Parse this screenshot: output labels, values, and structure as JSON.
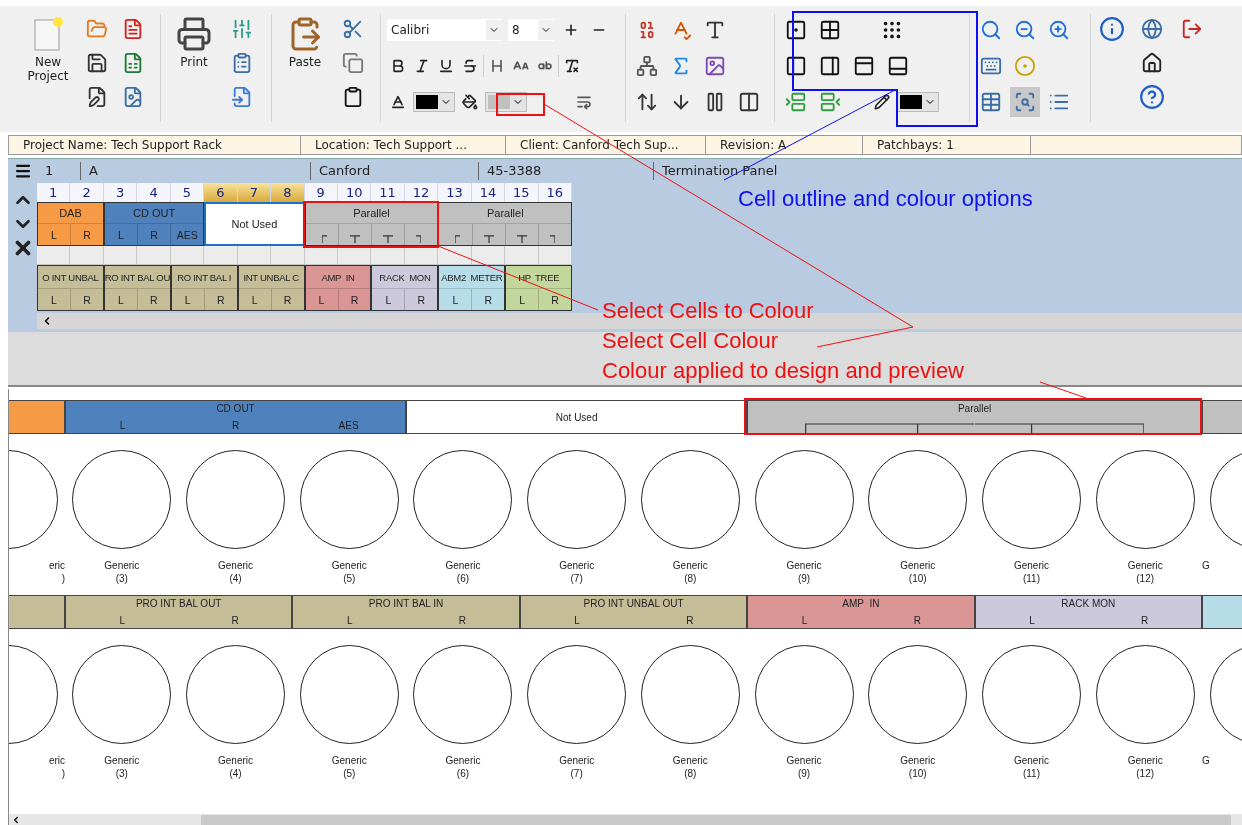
{
  "toolbar": {
    "new_project": "New Project",
    "print": "Print",
    "paste": "Paste",
    "font": "Calibri",
    "font_size": "8",
    "view_buttons": [
      {
        "pressed": false
      },
      {
        "pressed": true
      },
      {
        "pressed": false
      }
    ]
  },
  "project_bar": [
    "Project Name: Tech Support Rack",
    "Location: Tech Support ...",
    "Client: Canford Tech Sup...",
    "Revision: A",
    "Patchbays: 1"
  ],
  "editor": {
    "fields": [
      "1",
      "A",
      "Canford",
      "45-3388",
      "Termination Panel"
    ],
    "columns": [
      {
        "label": "1",
        "selected": false
      },
      {
        "label": "2",
        "selected": false
      },
      {
        "label": "3",
        "selected": false
      },
      {
        "label": "4",
        "selected": false
      },
      {
        "label": "5",
        "selected": false
      },
      {
        "label": "6",
        "selected": true
      },
      {
        "label": "7",
        "selected": true
      },
      {
        "label": "8",
        "selected": true
      },
      {
        "label": "9",
        "selected": false
      },
      {
        "label": "10",
        "selected": false
      },
      {
        "label": "11",
        "selected": false
      },
      {
        "label": "12",
        "selected": false
      },
      {
        "label": "13",
        "selected": false
      },
      {
        "label": "14",
        "selected": false
      },
      {
        "label": "15",
        "selected": false
      },
      {
        "label": "16",
        "selected": false
      }
    ],
    "top_groups": [
      {
        "label": "DAB",
        "color": "#f79a46",
        "selected": false,
        "ports": [
          {
            "kind": "label",
            "text": "L"
          },
          {
            "kind": "label",
            "text": "R"
          }
        ]
      },
      {
        "label": "CD OUT",
        "color": "#4f81bd",
        "selected": false,
        "ports": [
          {
            "kind": "label",
            "text": "L"
          },
          {
            "kind": "label",
            "text": "R"
          },
          {
            "kind": "label",
            "text": "AES"
          }
        ]
      },
      {
        "label": "Not Used",
        "color": "#ffffff",
        "selected": true,
        "ports": [
          {
            "kind": "blank"
          },
          {
            "kind": "blank"
          },
          {
            "kind": "blank"
          }
        ]
      },
      {
        "label": "Parallel",
        "color": "#c0c0c0",
        "selected": false,
        "ports": [
          {
            "kind": "first"
          },
          {
            "kind": "middle"
          },
          {
            "kind": "middle"
          },
          {
            "kind": "last"
          }
        ]
      },
      {
        "label": "Parallel",
        "color": "#c0c0c0",
        "selected": false,
        "ports": [
          {
            "kind": "first"
          },
          {
            "kind": "middle"
          },
          {
            "kind": "middle"
          },
          {
            "kind": "last"
          }
        ]
      }
    ],
    "bottom_groups": [
      {
        "label": "O INT UNBAL",
        "color": "#c4bd97",
        "selected": false,
        "ports": [
          {
            "kind": "label",
            "text": "L"
          },
          {
            "kind": "label",
            "text": "R"
          }
        ]
      },
      {
        "label": "RO INT BAL OU",
        "color": "#c4bd97",
        "selected": false,
        "ports": [
          {
            "kind": "label",
            "text": "L"
          },
          {
            "kind": "label",
            "text": "R"
          }
        ]
      },
      {
        "label": "RO INT BAL I",
        "color": "#c4bd97",
        "selected": false,
        "ports": [
          {
            "kind": "label",
            "text": "L"
          },
          {
            "kind": "label",
            "text": "R"
          }
        ]
      },
      {
        "label": "INT UNBAL C",
        "color": "#c4bd97",
        "selected": false,
        "ports": [
          {
            "kind": "label",
            "text": "L"
          },
          {
            "kind": "label",
            "text": "R"
          }
        ]
      },
      {
        "label": "AMP  IN",
        "color": "#d99694",
        "selected": false,
        "ports": [
          {
            "kind": "label",
            "text": "L"
          },
          {
            "kind": "label",
            "text": "R"
          }
        ]
      },
      {
        "label": "RACK  MON",
        "color": "#ccc9dc",
        "selected": false,
        "ports": [
          {
            "kind": "label",
            "text": "L"
          },
          {
            "kind": "label",
            "text": "R"
          }
        ]
      },
      {
        "label": "ABM2  METER",
        "color": "#b7dee8",
        "selected": false,
        "ports": [
          {
            "kind": "label",
            "text": "L"
          },
          {
            "kind": "label",
            "text": "R"
          }
        ]
      },
      {
        "label": "HP  TREE",
        "color": "#c3d69b",
        "selected": false,
        "ports": [
          {
            "kind": "label",
            "text": "L"
          },
          {
            "kind": "label",
            "text": "R"
          }
        ]
      }
    ]
  },
  "preview": {
    "rows": [
      {
        "groups": [
          {
            "color": "#f79a46",
            "ports": [
              {
                "kind": "blank"
              }
            ]
          },
          {
            "label": "CD OUT",
            "color": "#4f81bd",
            "ports": [
              {
                "kind": "label",
                "text": "L"
              },
              {
                "kind": "label",
                "text": "R"
              },
              {
                "kind": "label",
                "text": "AES"
              }
            ]
          },
          {
            "label": "Not Used",
            "color": "#ffffff",
            "ports": [
              {
                "kind": "blank"
              },
              {
                "kind": "blank"
              },
              {
                "kind": "blank"
              }
            ]
          },
          {
            "label": "Parallel",
            "color": "#c0c0c0",
            "ports": [
              {
                "kind": "first"
              },
              {
                "kind": "middle"
              },
              {
                "kind": "middle"
              },
              {
                "kind": "last"
              }
            ]
          },
          {
            "color": "#c0c0c0",
            "ports": [
              {
                "kind": "blank"
              }
            ]
          }
        ],
        "sockets": [
          {
            "name": "eric",
            "number": ")"
          },
          {
            "name": "Generic",
            "number": "(3)"
          },
          {
            "name": "Generic",
            "number": "(4)"
          },
          {
            "name": "Generic",
            "number": "(5)"
          },
          {
            "name": "Generic",
            "number": "(6)"
          },
          {
            "name": "Generic",
            "number": "(7)"
          },
          {
            "name": "Generic",
            "number": "(8)"
          },
          {
            "name": "Generic",
            "number": "(9)"
          },
          {
            "name": "Generic",
            "number": "(10)"
          },
          {
            "name": "Generic",
            "number": "(11)"
          },
          {
            "name": "Generic",
            "number": "(12)"
          },
          {
            "name": "G"
          }
        ]
      },
      {
        "groups": [
          {
            "color": "#c4bd97",
            "ports": [
              {
                "kind": "blank"
              }
            ]
          },
          {
            "label": "PRO INT BAL OUT",
            "color": "#c4bd97",
            "ports": [
              {
                "kind": "label",
                "text": "L"
              },
              {
                "kind": "label",
                "text": "R"
              }
            ]
          },
          {
            "label": "PRO INT BAL IN",
            "color": "#c4bd97",
            "ports": [
              {
                "kind": "label",
                "text": "L"
              },
              {
                "kind": "label",
                "text": "R"
              }
            ]
          },
          {
            "label": "PRO INT UNBAL OUT",
            "color": "#c4bd97",
            "ports": [
              {
                "kind": "label",
                "text": "L"
              },
              {
                "kind": "label",
                "text": "R"
              }
            ]
          },
          {
            "label": "AMP  IN",
            "color": "#d99694",
            "ports": [
              {
                "kind": "label",
                "text": "L"
              },
              {
                "kind": "label",
                "text": "R"
              }
            ]
          },
          {
            "label": "RACK MON",
            "color": "#ccc9dc",
            "ports": [
              {
                "kind": "label",
                "text": "L"
              },
              {
                "kind": "label",
                "text": "R"
              }
            ]
          },
          {
            "color": "#b7dee8",
            "ports": [
              {
                "kind": "blank"
              }
            ]
          }
        ],
        "sockets": [
          {
            "name": "eric",
            "number": ")"
          },
          {
            "name": "Generic",
            "number": "(3)"
          },
          {
            "name": "Generic",
            "number": "(4)"
          },
          {
            "name": "Generic",
            "number": "(5)"
          },
          {
            "name": "Generic",
            "number": "(6)"
          },
          {
            "name": "Generic",
            "number": "(7)"
          },
          {
            "name": "Generic",
            "number": "(8)"
          },
          {
            "name": "Generic",
            "number": "(9)"
          },
          {
            "name": "Generic",
            "number": "(10)"
          },
          {
            "name": "Generic",
            "number": "(11)"
          },
          {
            "name": "Generic",
            "number": "(12)"
          },
          {
            "name": "G"
          }
        ]
      }
    ]
  },
  "annotations": [
    {
      "kind": "blue",
      "text": "Cell outline and colour options"
    },
    {
      "kind": "red",
      "text": "Select Cells to Colour"
    },
    {
      "kind": "red",
      "text": "Select Cell Colour"
    },
    {
      "kind": "red",
      "text": "Colour applied to design and preview"
    }
  ]
}
